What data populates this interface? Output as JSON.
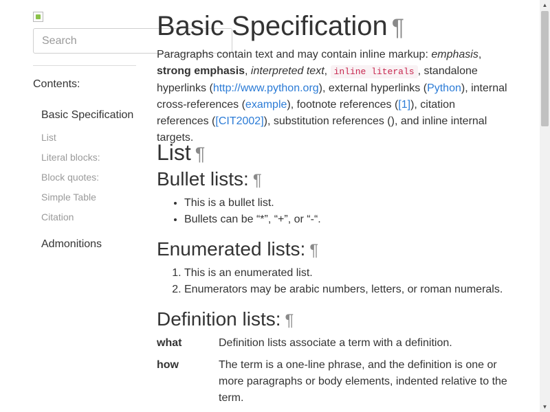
{
  "sidebar": {
    "search_placeholder": "Search",
    "contents_label": "Contents:",
    "toc": [
      {
        "label": "Basic Specification"
      },
      {
        "label": "List"
      },
      {
        "label": "Literal blocks:"
      },
      {
        "label": "Block quotes:"
      },
      {
        "label": "Simple Table"
      },
      {
        "label": "Citation"
      },
      {
        "label": "Admonitions"
      }
    ]
  },
  "main": {
    "title": "Basic Specification",
    "pilcrow": "¶",
    "intro": {
      "t1": "Paragraphs contain text and may contain inline markup: ",
      "emphasis": "emphasis",
      "t2": ", ",
      "strong": "strong emphasis",
      "t3": ", ",
      "interpreted": "interpreted text",
      "t4": ", ",
      "literal": "inline literals",
      "t5": ", standalone hyperlinks (",
      "link_python_org": "http://www.python.org",
      "t6": "), external hyperlinks (",
      "link_python": "Python",
      "t7": "), internal cross-references (",
      "link_example": "example",
      "t8": "), footnote references (",
      "link_footnote": "[1]",
      "t9": "), citation references (",
      "link_citation": "[CIT2002]",
      "t10": "), substitution references (), and inline internal targets."
    },
    "list_heading": "List",
    "bullet_heading": "Bullet lists:",
    "bullets": [
      "This is a bullet list.",
      "Bullets can be “*”, “+”, or “-“."
    ],
    "enum_heading": "Enumerated lists:",
    "enumerated": [
      "This is an enumerated list.",
      "Enumerators may be arabic numbers, letters, or roman numerals."
    ],
    "def_heading": "Definition lists:",
    "definitions": [
      {
        "term": "what",
        "def": "Definition lists associate a term with a definition."
      },
      {
        "term": "how",
        "def": "The term is a one-line phrase, and the definition is one or more paragraphs or body elements, indented relative to the term."
      }
    ]
  },
  "scrollbar": {
    "up_icon": "▲",
    "down_icon": "▼"
  }
}
